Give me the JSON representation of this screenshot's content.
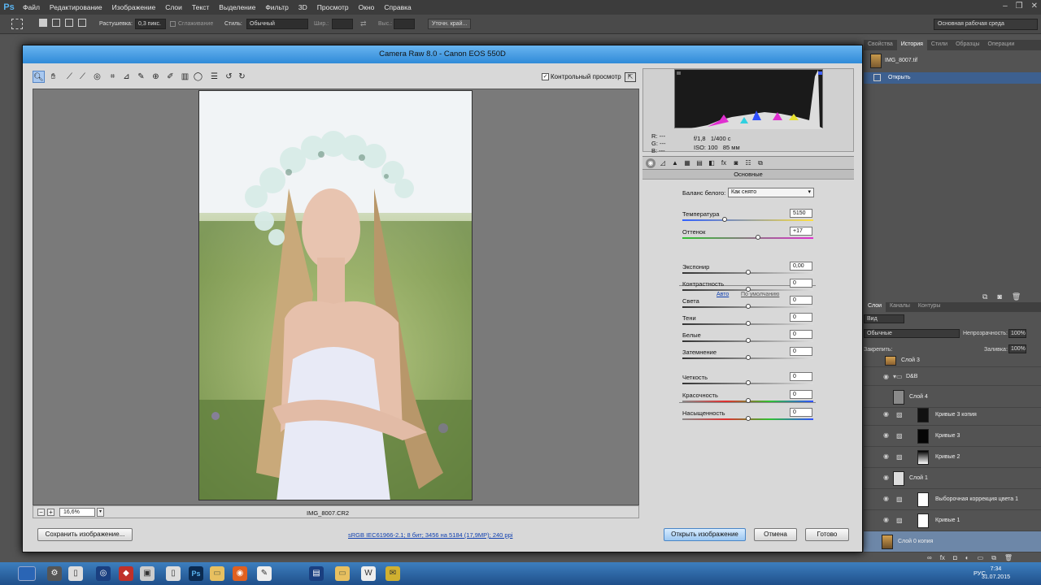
{
  "menubar": {
    "logo": "Ps",
    "items": [
      "Файл",
      "Редактирование",
      "Изображение",
      "Слои",
      "Текст",
      "Выделение",
      "Фильтр",
      "3D",
      "Просмотр",
      "Окно",
      "Справка"
    ]
  },
  "options": {
    "feather_label": "Растушевка:",
    "feather_value": "0,3 пикс.",
    "smooth_label": "Сглаживание",
    "style_label": "Стиль:",
    "style_value": "Обычный",
    "width_label": "Шир.:",
    "height_label": "Выс.:",
    "refine_btn": "Уточн. край...",
    "workspace": "Основная рабочая среда"
  },
  "history": {
    "tabs": [
      "Свойства",
      "История",
      "Стили",
      "Образцы",
      "Операции"
    ],
    "active_tab": "История",
    "snapshot": "IMG_8007.tif",
    "step": "Открыть"
  },
  "layers": {
    "tabs": [
      "Слои",
      "Каналы",
      "Контуры"
    ],
    "kind_filter": "Вид",
    "blend_mode": "Обычные",
    "opacity_label": "Непрозрачность:",
    "opacity": "100%",
    "lock_label": "Закрепить:",
    "fill_label": "Заливка:",
    "fill": "100%",
    "items": [
      "Слой 3",
      "D&B",
      "Слой 4",
      "Кривые 3 копия",
      "Кривые 3",
      "Кривые 2",
      "Слой 1",
      "Выборочная коррекция цвета 1",
      "Кривые 1",
      "Слой 0 копия"
    ]
  },
  "camera_raw": {
    "title": "Camera Raw 8.0  -  Canon EOS 550D",
    "preview_label": "Контрольный просмотр",
    "preview_checked": "✓",
    "zoom": "16,6%",
    "file": "IMG_8007.CR2",
    "save_btn": "Сохранить изображение...",
    "workflow": "sRGB IEC61966-2.1; 8 бит; 3456 на 5184 (17,9МР); 240 ppi",
    "open_btn": "Открыть изображение",
    "cancel_btn": "Отмена",
    "done_btn": "Готово",
    "readout": {
      "r": "R:  ---",
      "g": "G:  ---",
      "b": "B:  ---"
    },
    "exif": {
      "aperture": "f/1,8",
      "shutter": "1/400 с",
      "iso": "ISO: 100",
      "focal": "85 мм"
    },
    "panel_title": "Основные",
    "wb_label": "Баланс белого:",
    "wb_value": "Как снято",
    "auto": "Авто",
    "default": "По умолчанию",
    "sliders": [
      {
        "label": "Температура",
        "value": "5150",
        "pos": 0.32
      },
      {
        "label": "Оттенок",
        "value": "+17",
        "pos": 0.58
      },
      {
        "label": "Экспонир",
        "value": "0,00",
        "pos": 0.5
      },
      {
        "label": "Контрастность",
        "value": "0",
        "pos": 0.5
      },
      {
        "label": "Света",
        "value": "0",
        "pos": 0.5
      },
      {
        "label": "Тени",
        "value": "0",
        "pos": 0.5
      },
      {
        "label": "Белые",
        "value": "0",
        "pos": 0.5
      },
      {
        "label": "Затемнение",
        "value": "0",
        "pos": 0.5
      },
      {
        "label": "Четкость",
        "value": "0",
        "pos": 0.5
      },
      {
        "label": "Красочность",
        "value": "0",
        "pos": 0.5
      },
      {
        "label": "Насыщенность",
        "value": "0",
        "pos": 0.5
      }
    ]
  },
  "taskbar": {
    "lang": "РУС",
    "time": "7:34",
    "date": "31.07.2015"
  }
}
